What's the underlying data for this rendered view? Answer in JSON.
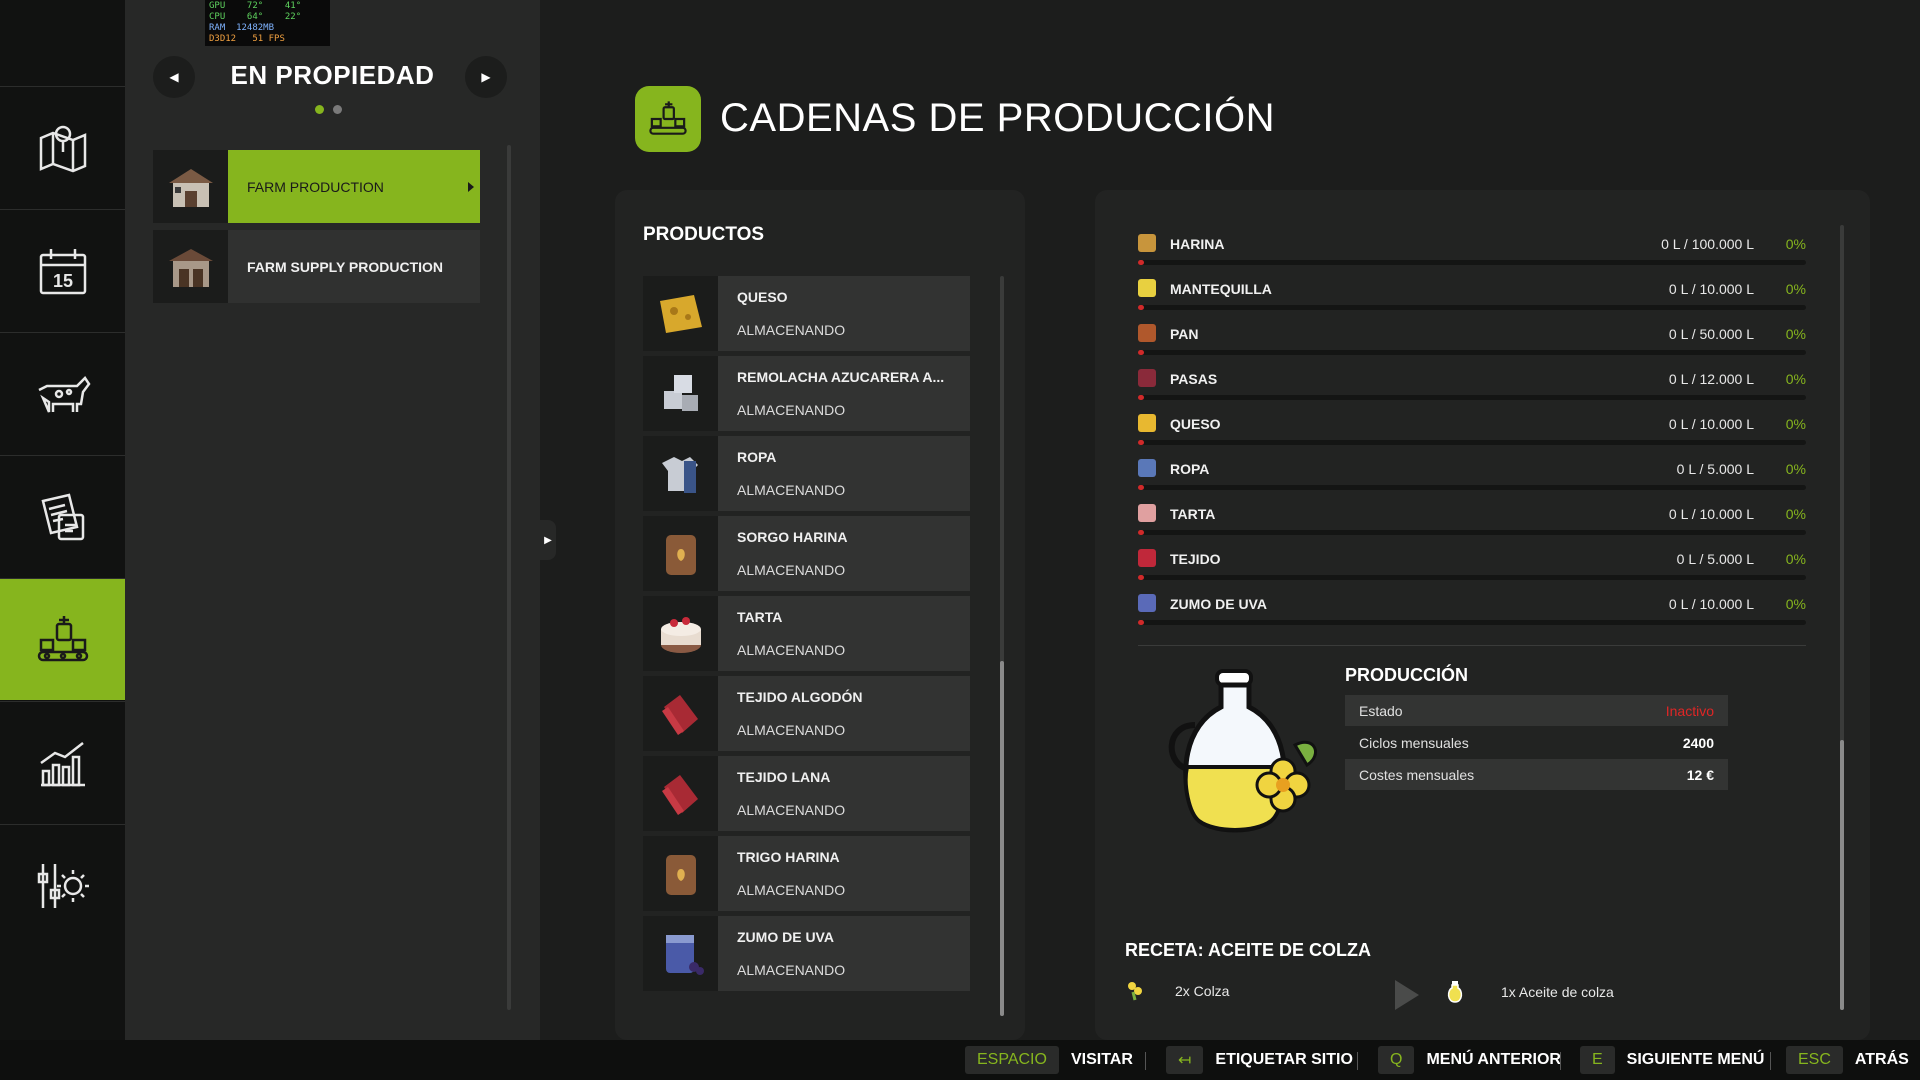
{
  "perf_overlay": {
    "line1": "GPU    72°    41°",
    "line2": "CPU    64°    22°",
    "line3": "RAM  12482MB",
    "line4": "D3D12   51 FPS"
  },
  "left_panel": {
    "title": "EN PROPIEDAD",
    "prev_icon": "◀",
    "next_icon": "▶",
    "items": [
      {
        "label": "FARM PRODUCTION"
      },
      {
        "label": "FARM SUPPLY PRODUCTION"
      }
    ]
  },
  "sidebar": {
    "icons": [
      "map-icon",
      "calendar-icon",
      "cow-icon",
      "contracts-icon",
      "production-icon",
      "statistics-icon",
      "settings-icon"
    ],
    "calendar_day": "15"
  },
  "header": {
    "title": "CADENAS DE PRODUCCIÓN"
  },
  "products": {
    "title": "PRODUCTOS",
    "items": [
      {
        "name": "QUESO",
        "status": "ALMACENANDO"
      },
      {
        "name": "REMOLACHA AZUCARERA A...",
        "status": "ALMACENANDO"
      },
      {
        "name": "ROPA",
        "status": "ALMACENANDO"
      },
      {
        "name": "SORGO HARINA",
        "status": "ALMACENANDO"
      },
      {
        "name": "TARTA",
        "status": "ALMACENANDO"
      },
      {
        "name": "TEJIDO ALGODÓN",
        "status": "ALMACENANDO"
      },
      {
        "name": "TEJIDO LANA",
        "status": "ALMACENANDO"
      },
      {
        "name": "TRIGO HARINA",
        "status": "ALMACENANDO"
      },
      {
        "name": "ZUMO DE UVA",
        "status": "ALMACENANDO"
      }
    ]
  },
  "storage": {
    "rows": [
      {
        "name": "HARINA",
        "amount": "0 L / 100.000 L",
        "percent": "0%",
        "color": "#c8953c"
      },
      {
        "name": "MANTEQUILLA",
        "amount": "0 L / 10.000 L",
        "percent": "0%",
        "color": "#e8d040"
      },
      {
        "name": "PAN",
        "amount": "0 L / 50.000 L",
        "percent": "0%",
        "color": "#b0582c"
      },
      {
        "name": "PASAS",
        "amount": "0 L / 12.000 L",
        "percent": "0%",
        "color": "#8a2a3a"
      },
      {
        "name": "QUESO",
        "amount": "0 L / 10.000 L",
        "percent": "0%",
        "color": "#e8b830"
      },
      {
        "name": "ROPA",
        "amount": "0 L / 5.000 L",
        "percent": "0%",
        "color": "#5a78b8"
      },
      {
        "name": "TARTA",
        "amount": "0 L / 10.000 L",
        "percent": "0%",
        "color": "#e0a0a0"
      },
      {
        "name": "TEJIDO",
        "amount": "0 L / 5.000 L",
        "percent": "0%",
        "color": "#c0283a"
      },
      {
        "name": "ZUMO DE UVA",
        "amount": "0 L / 10.000 L",
        "percent": "0%",
        "color": "#5a6ab8"
      }
    ],
    "fill_fraction": 0
  },
  "production": {
    "title": "PRODUCCIÓN",
    "rows": [
      {
        "key": "Estado",
        "value": "Inactivo"
      },
      {
        "key": "Ciclos mensuales",
        "value": "2400"
      },
      {
        "key": "Costes mensuales",
        "value": "12 €"
      }
    ]
  },
  "recipe": {
    "title": "RECETA: ACEITE DE COLZA",
    "input": "2x Colza",
    "output": "1x Aceite de colza"
  },
  "bottom_bar": {
    "hints": [
      {
        "key": "ESPACIO",
        "label": "VISITAR"
      },
      {
        "key": "↤",
        "label": "ETIQUETAR SITIO"
      },
      {
        "key": "Q",
        "label": "MENÚ ANTERIOR"
      },
      {
        "key": "E",
        "label": "SIGUIENTE MENÚ"
      },
      {
        "key": "ESC",
        "label": "ATRÁS"
      }
    ]
  },
  "colors": {
    "accent": "#86b51e",
    "inactive": "#e02626"
  }
}
